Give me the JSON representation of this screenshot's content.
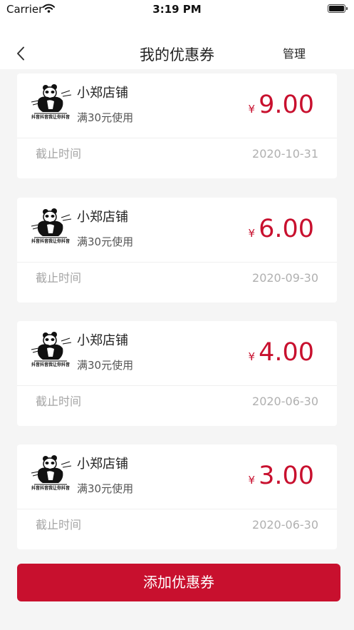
{
  "status_bar": {
    "carrier": "Carrier",
    "time": "3:19 PM",
    "wifi_icon": "wifi-icon",
    "battery_icon": "battery-icon"
  },
  "nav": {
    "back_icon": "chevron-left-icon",
    "title": "我的优惠券",
    "manage_label": "管理"
  },
  "coupons": [
    {
      "logo_caption": "抖音抖音我让你抖音",
      "shop_name": "小郑店铺",
      "condition": "满30元使用",
      "currency": "¥",
      "amount": "9.00",
      "expiry_label": "截止时间",
      "expiry_date": "2020-10-31"
    },
    {
      "logo_caption": "抖音抖音我让你抖音",
      "shop_name": "小郑店铺",
      "condition": "满30元使用",
      "currency": "¥",
      "amount": "6.00",
      "expiry_label": "截止时间",
      "expiry_date": "2020-09-30"
    },
    {
      "logo_caption": "抖音抖音我让你抖音",
      "shop_name": "小郑店铺",
      "condition": "满30元使用",
      "currency": "¥",
      "amount": "4.00",
      "expiry_label": "截止时间",
      "expiry_date": "2020-06-30"
    },
    {
      "logo_caption": "抖音抖音我让你抖音",
      "shop_name": "小郑店铺",
      "condition": "满30元使用",
      "currency": "¥",
      "amount": "3.00",
      "expiry_label": "截止时间",
      "expiry_date": "2020-06-30"
    }
  ],
  "add_button_label": "添加优惠券",
  "colors": {
    "accent": "#c8102e",
    "background": "#f5f5f5"
  }
}
